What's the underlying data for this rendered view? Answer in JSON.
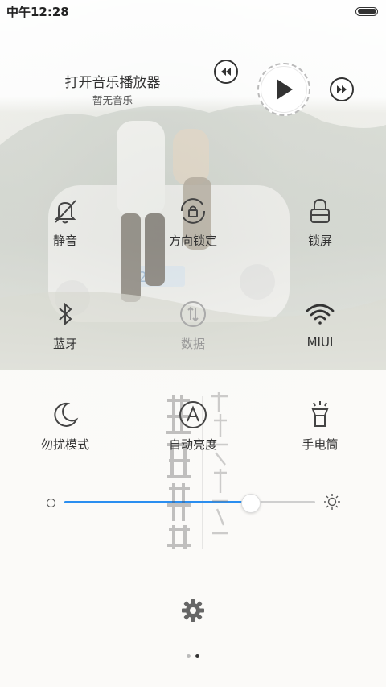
{
  "status_bar": {
    "time": "中午12:28"
  },
  "music_player": {
    "title": "打开音乐播放器",
    "subtitle": "暂无音乐",
    "prev_icon": "rewind-icon",
    "play_icon": "play-icon",
    "next_icon": "fast-forward-icon"
  },
  "toggles": [
    {
      "label": "静音",
      "icon": "bell-muted-icon",
      "enabled": true
    },
    {
      "label": "方向锁定",
      "icon": "rotation-lock-icon",
      "enabled": true
    },
    {
      "label": "锁屏",
      "icon": "lock-icon",
      "enabled": true
    },
    {
      "label": "蓝牙",
      "icon": "bluetooth-icon",
      "enabled": true
    },
    {
      "label": "数据",
      "icon": "mobile-data-icon",
      "enabled": false
    },
    {
      "label": "MIUI",
      "icon": "wifi-icon",
      "enabled": true
    },
    {
      "label": "勿扰模式",
      "icon": "moon-icon",
      "enabled": true
    },
    {
      "label": "自动亮度",
      "icon": "auto-brightness-icon",
      "enabled": true
    },
    {
      "label": "手电筒",
      "icon": "flashlight-icon",
      "enabled": true
    }
  ],
  "brightness": {
    "level": 0.74,
    "accent": "#2a8ef0"
  },
  "pager": {
    "pages": 2,
    "current": 2
  }
}
